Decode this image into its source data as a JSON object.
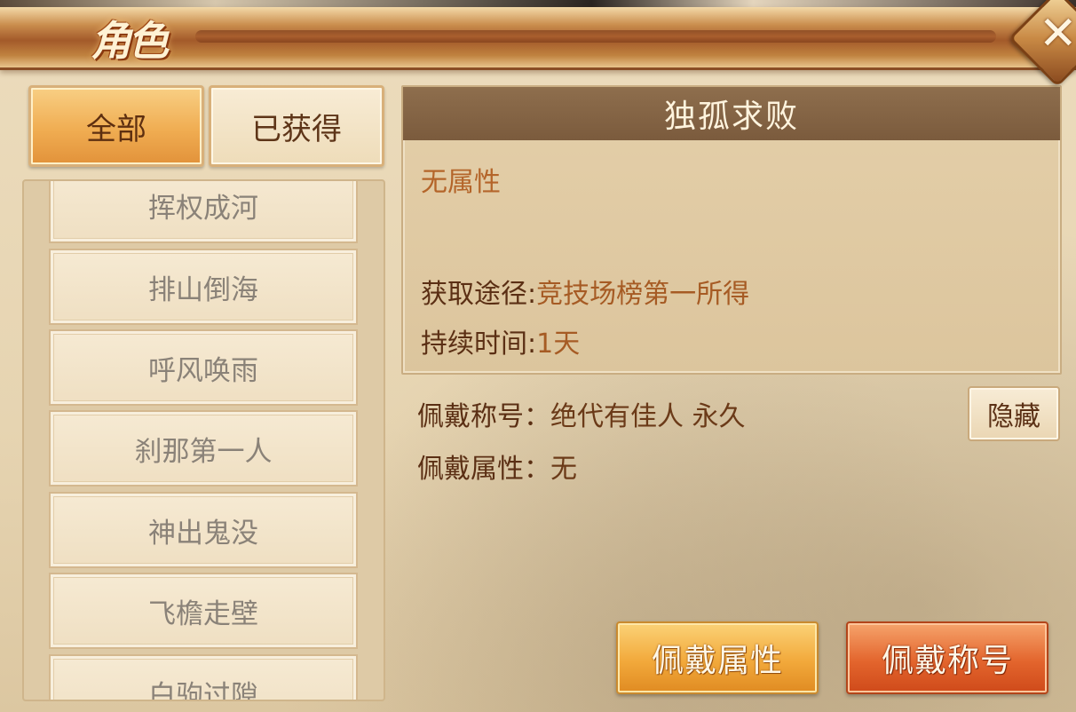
{
  "header": {
    "title": "角色",
    "close_label": "✕"
  },
  "tabs": {
    "all": "全部",
    "obtained": "已获得"
  },
  "list": {
    "items": [
      {
        "label": "挥权成河"
      },
      {
        "label": "排山倒海"
      },
      {
        "label": "呼风唤雨"
      },
      {
        "label": "刹那第一人"
      },
      {
        "label": "神出鬼没"
      },
      {
        "label": "飞檐走壁"
      },
      {
        "label": "白驹过隙"
      }
    ]
  },
  "detail": {
    "title": "独孤求败",
    "attribute": "无属性",
    "source_label": "获取途径:",
    "source_value": "竞技场榜第一所得",
    "duration_label": "持续时间:",
    "duration_value": "1天"
  },
  "wearing": {
    "title_label": "佩戴称号：",
    "title_value": "绝代有佳人 永久",
    "attr_label": "佩戴属性：",
    "attr_value": "无",
    "hide_label": "隐藏"
  },
  "actions": {
    "wear_attribute": "佩戴属性",
    "wear_title": "佩戴称号"
  },
  "colors": {
    "accent_orange": "#f0ad52",
    "accent_red": "#e3652d",
    "text_brown": "#5b2f14"
  }
}
